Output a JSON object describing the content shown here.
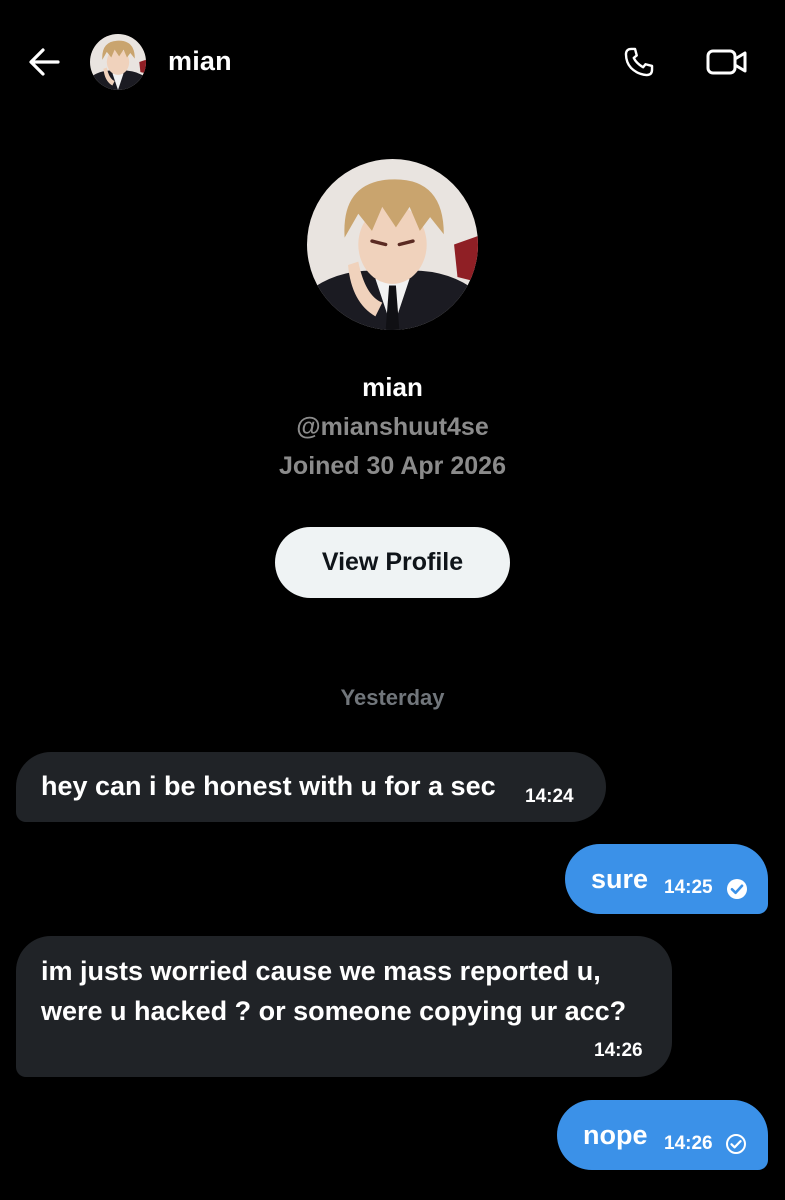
{
  "header": {
    "name": "mian",
    "back_icon": "arrow-left-icon",
    "call_icon": "phone-icon",
    "video_icon": "video-camera-icon"
  },
  "profile": {
    "name": "mian",
    "handle": "@mianshuut4se",
    "joined": "Joined 30 Apr 2026",
    "view_profile_label": "View Profile"
  },
  "date_separator": "Yesterday",
  "messages": [
    {
      "direction": "incoming",
      "lines": [
        "hey can i be honest with u for a sec"
      ],
      "time": "14:24"
    },
    {
      "direction": "outgoing",
      "lines": [
        "sure"
      ],
      "time": "14:25",
      "status": "read"
    },
    {
      "direction": "incoming",
      "lines": [
        "im justs worried cause we mass reported u,",
        "were u hacked ? or someone copying ur acc?"
      ],
      "time": "14:26"
    },
    {
      "direction": "outgoing",
      "lines": [
        "nope"
      ],
      "time": "14:26",
      "status": "sent"
    }
  ],
  "colors": {
    "background": "#000000",
    "incoming_bubble": "#202327",
    "outgoing_bubble": "#3b91e8",
    "muted_text": "#8b8b8b",
    "button_bg": "#eff3f4"
  }
}
